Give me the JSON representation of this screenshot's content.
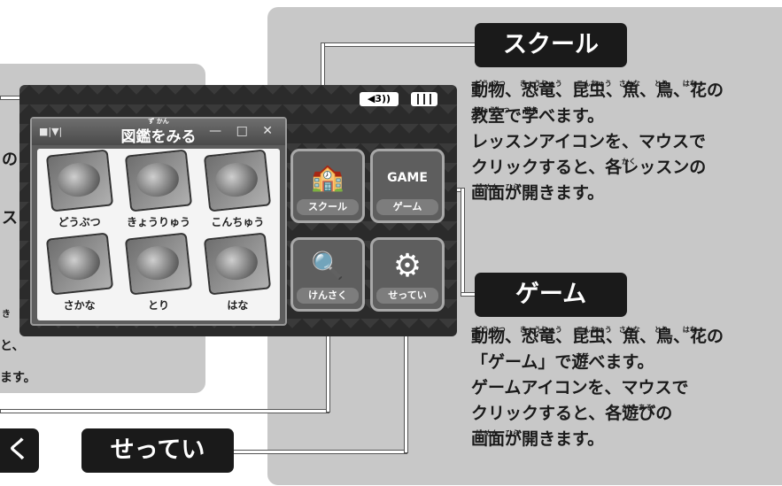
{
  "left_panel": {
    "fragments": [
      "の",
      "ス",
      "と、",
      "ます。",
      "き"
    ],
    "tag_fragment": "く"
  },
  "device": {
    "status": {
      "sound_label": "◀3))",
      "battery": "full"
    },
    "zukan_window": {
      "title": "図鑑をみる",
      "title_ruby": "ず かん",
      "controls": "— □ ✕",
      "menu_glyph": "■|▼|",
      "items": [
        {
          "label": "どうぶつ",
          "icon": "animal-book-icon"
        },
        {
          "label": "きょうりゅう",
          "icon": "dinosaur-book-icon"
        },
        {
          "label": "こんちゅう",
          "icon": "insect-book-icon"
        },
        {
          "label": "さかな",
          "icon": "fish-book-icon"
        },
        {
          "label": "とり",
          "icon": "bird-book-icon"
        },
        {
          "label": "はな",
          "icon": "flower-book-icon"
        }
      ]
    },
    "menu_buttons": {
      "school": {
        "label": "スクール",
        "glyph": "🏫"
      },
      "game": {
        "label": "ゲーム",
        "glyph": "GAME"
      },
      "search": {
        "label": "けんさく",
        "glyph": "🔍"
      },
      "settings": {
        "label": "せってい",
        "glyph": "⚙"
      }
    }
  },
  "callouts": {
    "school": {
      "tag": "スクール",
      "ruby_line1": "どう ぶつ　　きょうりゅう　　こんちゅう　さかな　　とり　　はな",
      "ruby_line2": "きょうしつ　　まな",
      "ruby_line4": "かく",
      "ruby_line5": "が めん　ひら",
      "lines": [
        "動物、恐竜、昆虫、魚、鳥、花の",
        "教室で学べます。",
        "レッスンアイコンを、マウスで",
        "クリックすると、各レッスンの",
        "画面が開きます。"
      ]
    },
    "game": {
      "tag": "ゲーム",
      "ruby_line1": "どう ぶつ　　きょうりゅう　　こんちゅう　さかな　　とり　　はな",
      "ruby_line2": "あそ",
      "ruby_line4": "かく あそ",
      "ruby_line5": "が めん　ひら",
      "lines": [
        "動物、恐竜、昆虫、魚、鳥、花の",
        "「ゲーム」で遊べます。",
        "ゲームアイコンを、マウスで",
        "クリックすると、各遊びの",
        "画面が開きます。"
      ]
    },
    "settings": {
      "tag": "せってい"
    }
  }
}
